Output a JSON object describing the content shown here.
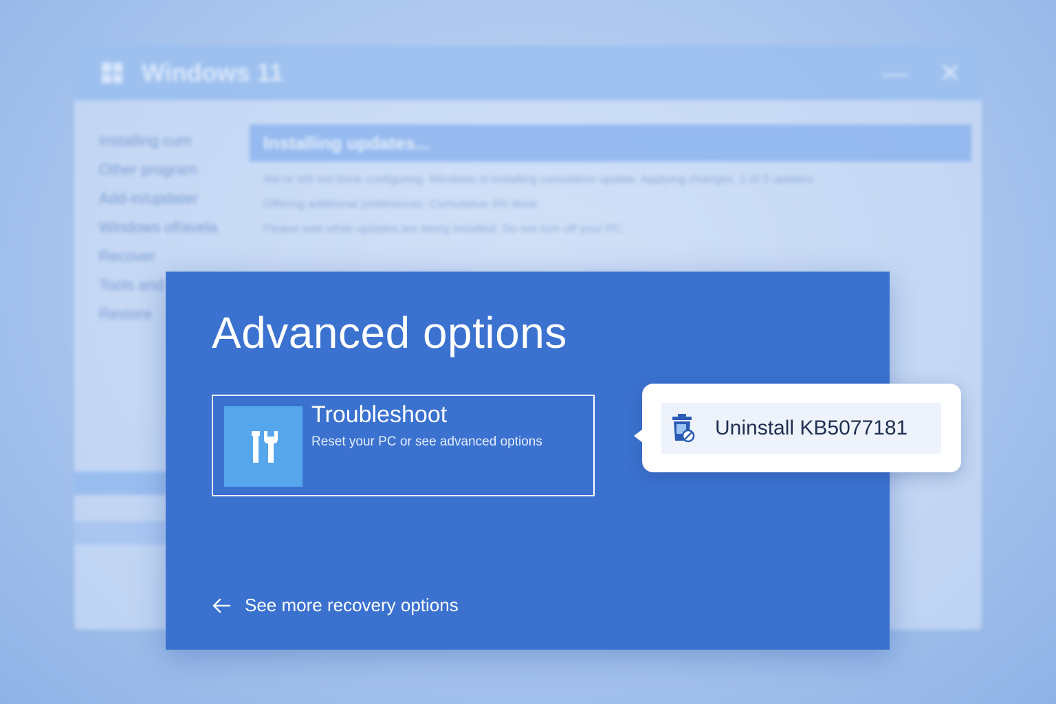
{
  "background_window": {
    "title": "Windows 11",
    "minimize_glyph": "—",
    "close_glyph": "✕",
    "sidebar_items": [
      "Installing cum",
      "Other program",
      "Add-in/updater",
      "Windows of/avela",
      "Recover",
      "Tools and",
      "Restore"
    ],
    "header": "Installing updates...",
    "lines": [
      "We're still not done configuring. Windows is installing cumulative update. Applying changes. 1 of 3 updates",
      "Offering additional preferences. Cumulative 3% done.",
      "Please wait while updates are being installed. Do not turn off your PC."
    ]
  },
  "panel": {
    "title": "Advanced options",
    "option": {
      "icon": "tools-icon",
      "title": "Troubleshoot",
      "description": "Reset your PC or see advanced options"
    },
    "more_link": {
      "icon": "arrow-left-icon",
      "label": "See more recovery options"
    }
  },
  "callout": {
    "icon": "uninstall-update-icon",
    "label": "Uninstall KB5077181"
  },
  "colors": {
    "panel_bg": "#3b72cf",
    "tile_icon_bg": "#56a6ec",
    "callout_text": "#1f2f52",
    "page_bg": "#aac6ee"
  }
}
